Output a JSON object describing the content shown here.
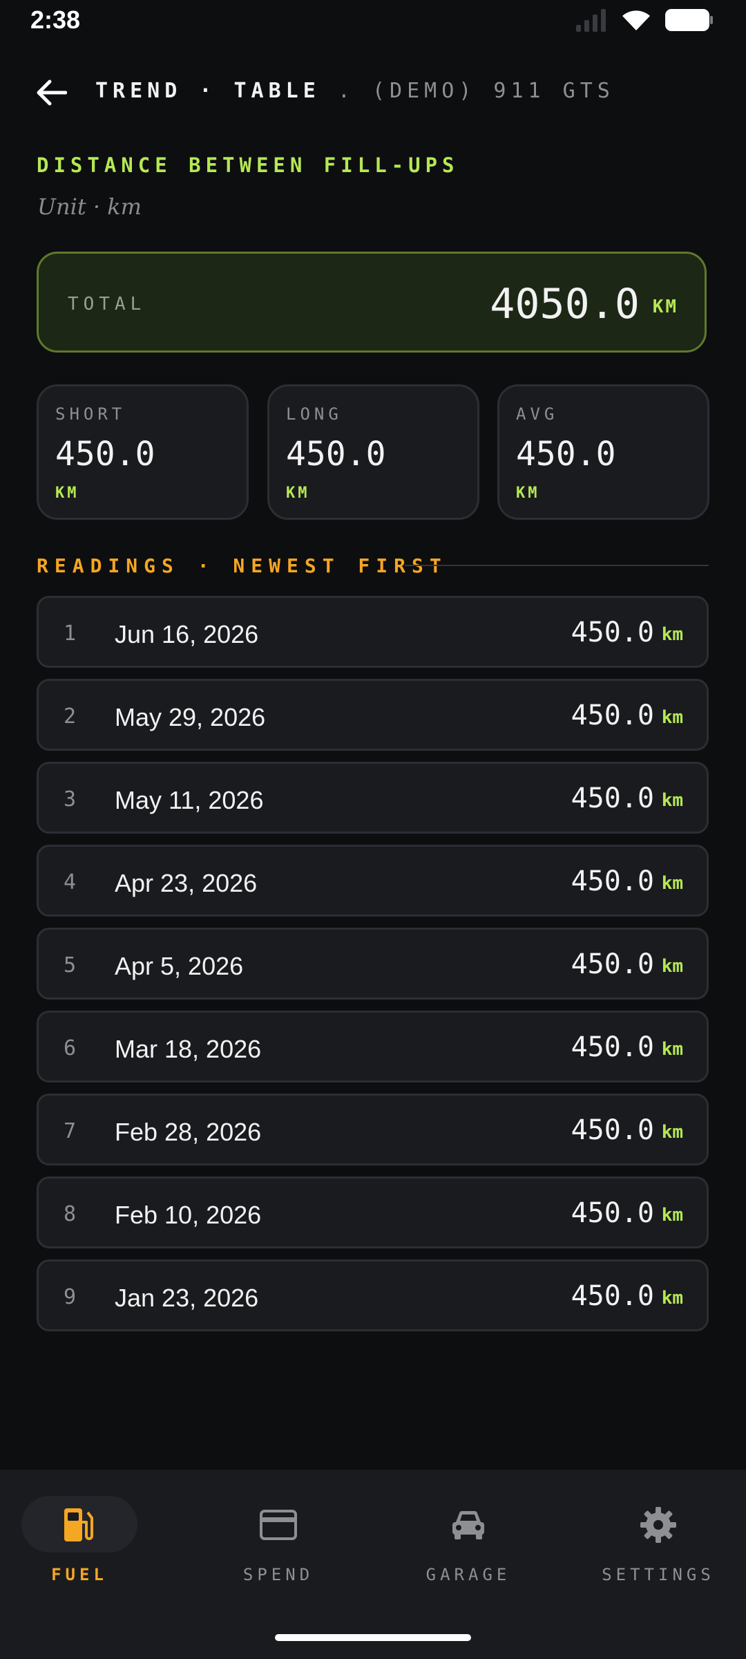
{
  "status_bar": {
    "time": "2:38"
  },
  "header": {
    "title": "TREND · TABLE",
    "subtitle": ". (DEMO) 911 GTS"
  },
  "metric": {
    "title": "DISTANCE BETWEEN FILL-UPS",
    "unit_line": "Unit · km"
  },
  "total": {
    "label": "TOTAL",
    "value": "4050.0",
    "unit": "KM"
  },
  "stats": [
    {
      "label": "SHORT",
      "value": "450.0",
      "unit": "KM"
    },
    {
      "label": "LONG",
      "value": "450.0",
      "unit": "KM"
    },
    {
      "label": "AVG",
      "value": "450.0",
      "unit": "KM"
    }
  ],
  "readings": {
    "heading": "READINGS · NEWEST FIRST",
    "rows": [
      {
        "index": "1",
        "date": "Jun 16, 2026",
        "value": "450.0",
        "unit": "km"
      },
      {
        "index": "2",
        "date": "May 29, 2026",
        "value": "450.0",
        "unit": "km"
      },
      {
        "index": "3",
        "date": "May 11, 2026",
        "value": "450.0",
        "unit": "km"
      },
      {
        "index": "4",
        "date": "Apr 23, 2026",
        "value": "450.0",
        "unit": "km"
      },
      {
        "index": "5",
        "date": "Apr 5, 2026",
        "value": "450.0",
        "unit": "km"
      },
      {
        "index": "6",
        "date": "Mar 18, 2026",
        "value": "450.0",
        "unit": "km"
      },
      {
        "index": "7",
        "date": "Feb 28, 2026",
        "value": "450.0",
        "unit": "km"
      },
      {
        "index": "8",
        "date": "Feb 10, 2026",
        "value": "450.0",
        "unit": "km"
      },
      {
        "index": "9",
        "date": "Jan 23, 2026",
        "value": "450.0",
        "unit": "km"
      }
    ]
  },
  "nav": {
    "items": [
      {
        "label": "FUEL",
        "icon": "fuel-pump-icon",
        "active": true
      },
      {
        "label": "SPEND",
        "icon": "credit-card-icon",
        "active": false
      },
      {
        "label": "GARAGE",
        "icon": "car-icon",
        "active": false
      },
      {
        "label": "SETTINGS",
        "icon": "gear-icon",
        "active": false
      }
    ]
  },
  "colors": {
    "accent_green": "#b5e853",
    "accent_orange": "#f5a623",
    "background": "#0d0e10",
    "card": "#1a1b1f"
  }
}
